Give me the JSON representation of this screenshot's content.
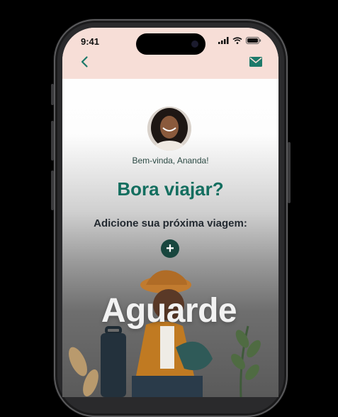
{
  "status_bar": {
    "time": "9:41"
  },
  "header": {
    "back_icon": "chevron-left-icon",
    "mail_icon": "mail-icon"
  },
  "profile": {
    "welcome": "Bem-vinda, Ananda!"
  },
  "main": {
    "headline": "Bora viajar?",
    "subline": "Adicione sua próxima viagem:",
    "add_label": "+"
  },
  "overlay": {
    "text": "Aguarde"
  },
  "colors": {
    "header_bg": "#f7ded7",
    "accent_green": "#136e5f",
    "dark_green": "#18463e",
    "icon_teal": "#1d7a6a"
  }
}
